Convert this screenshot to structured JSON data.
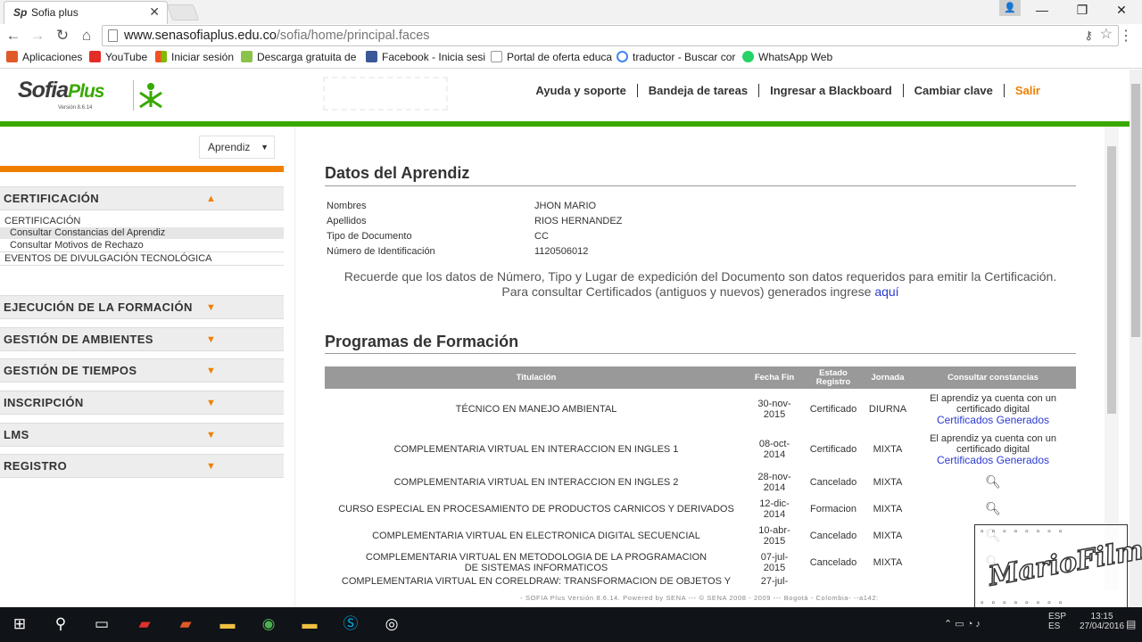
{
  "browser": {
    "tab_title": "Sofia plus",
    "tab_icon": "Sp",
    "url_host": "www.senasofiaplus.edu.co",
    "url_path": "/sofia/home/principal.faces",
    "bookmarks": [
      {
        "label": "Aplicaciones",
        "color": "#e05a28"
      },
      {
        "label": "YouTube",
        "color": "#e52d27"
      },
      {
        "label": "Iniciar sesión",
        "color": "#f25022"
      },
      {
        "label": "Descarga gratuita de",
        "color": "#f2b400"
      },
      {
        "label": "Facebook - Inicia sesi",
        "color": "#3b5998"
      },
      {
        "label": "Portal de oferta educa",
        "color": "#444444"
      },
      {
        "label": "traductor - Buscar cor",
        "color": "#4285f4"
      },
      {
        "label": "WhatsApp Web",
        "color": "#25d366"
      }
    ]
  },
  "header": {
    "logo_main": "Sofia",
    "logo_plus": "Plus",
    "logo_version": "Versión 8.6.14",
    "nav": [
      "Ayuda y soporte",
      "Bandeja de tareas",
      "Ingresar a Blackboard",
      "Cambiar clave"
    ],
    "nav_exit": "Salir"
  },
  "sidebar": {
    "role": "Aprendiz",
    "sections": [
      {
        "label": "CERTIFICACIÓN",
        "expanded": true
      },
      {
        "label": "EJECUCIÓN DE LA FORMACIÓN"
      },
      {
        "label": "GESTIÓN DE AMBIENTES"
      },
      {
        "label": "GESTIÓN DE TIEMPOS"
      },
      {
        "label": "INSCRIPCIÓN"
      },
      {
        "label": "LMS"
      },
      {
        "label": "REGISTRO"
      }
    ],
    "submenu": {
      "group": "CERTIFICACIÓN",
      "items": [
        "Consultar Constancias del Aprendiz",
        "Consultar Motivos de Rechazo"
      ],
      "group2": "EVENTOS DE DIVULGACIÓN TECNOLÓGICA"
    }
  },
  "content": {
    "title_student": "Datos del Aprendiz",
    "fields": [
      {
        "label": "Nombres",
        "value": "JHON MARIO"
      },
      {
        "label": "Apellidos",
        "value": "RIOS HERNANDEZ"
      },
      {
        "label": "Tipo de Documento",
        "value": "CC"
      },
      {
        "label": "Número de Identificación",
        "value": "1120506012"
      }
    ],
    "note1": "Recuerde que los datos de Número, Tipo y Lugar de expedición del Documento son datos requeridos para emitir la Certificación.",
    "note2": "Para consultar Certificados (antiguos y nuevos) generados ingrese",
    "note2_link": "aquí",
    "title_programs": "Programas de Formación",
    "table": {
      "headers": [
        "Titulación",
        "Fecha Fin",
        "Estado Registro",
        "Jornada",
        "Consultar constancias"
      ],
      "rows": [
        {
          "titulo": "TÉCNICO EN MANEJO AMBIENTAL",
          "fecha": "30-nov-2015",
          "estado": "Certificado",
          "jornada": "DIURNA",
          "text": "El aprendiz ya cuenta con un certificado digital",
          "link": "Certificados Generados"
        },
        {
          "titulo": "COMPLEMENTARIA VIRTUAL EN INTERACCION EN INGLES 1",
          "fecha": "08-oct-2014",
          "estado": "Certificado",
          "jornada": "MIXTA",
          "text": "El aprendiz ya cuenta con un certificado digital",
          "link": "Certificados Generados"
        },
        {
          "titulo": "COMPLEMENTARIA VIRTUAL EN INTERACCION EN INGLES 2",
          "fecha": "28-nov-2014",
          "estado": "Cancelado",
          "jornada": "MIXTA"
        },
        {
          "titulo": "CURSO ESPECIAL EN PROCESAMIENTO DE PRODUCTOS CARNICOS Y DERIVADOS",
          "fecha": "12-dic-2014",
          "estado": "Formacion",
          "jornada": "MIXTA"
        },
        {
          "titulo": "COMPLEMENTARIA VIRTUAL EN ELECTRONICA DIGITAL SECUENCIAL",
          "fecha": "10-abr-2015",
          "estado": "Cancelado",
          "jornada": "MIXTA"
        },
        {
          "titulo": "COMPLEMENTARIA VIRTUAL EN METODOLOGIA DE LA PROGRAMACION DE SISTEMAS INFORMATICOS",
          "fecha": "07-jul-2015",
          "estado": "Cancelado",
          "jornada": "MIXTA"
        },
        {
          "titulo": "COMPLEMENTARIA VIRTUAL EN CORELDRAW: TRANSFORMACION DE OBJETOS Y",
          "fecha": "27-jul-",
          "estado": "",
          "jornada": ""
        }
      ]
    },
    "footer": "- SOFIA Plus Versión 8.6.14. Powered by SENA --- © SENA 2008 - 2009 --- Bogotá - Colombia- --a142:"
  },
  "watermark": "MarioFilms",
  "taskbar": {
    "lang1": "ESP",
    "lang2": "ES",
    "time": "13:15",
    "date": "27/04/2016"
  }
}
